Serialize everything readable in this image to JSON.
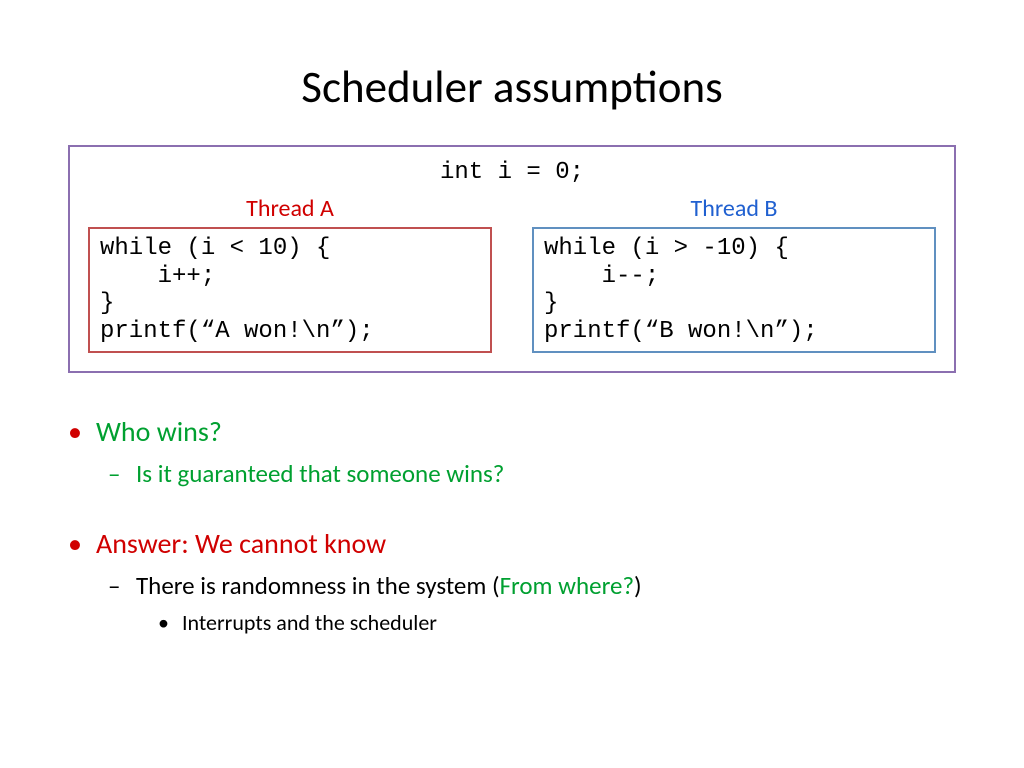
{
  "title": "Scheduler assumptions",
  "sharedCode": "int i = 0;",
  "threadA": {
    "label": "Thread A",
    "code": "while (i < 10) {\n    i++;\n}\nprintf(“A won!\\n”);"
  },
  "threadB": {
    "label": "Thread B",
    "code": "while (i > -10) {\n    i--;\n}\nprintf(“B won!\\n”);"
  },
  "bullets": {
    "q1": "Who wins?",
    "q1sub": "Is it guaranteed that someone wins?",
    "answer": "Answer: We cannot know",
    "answerSubPre": "There is randomness in the system (",
    "answerSubGreen": "From where?",
    "answerSubPost": ")",
    "answerSubSub": "Interrupts and the scheduler"
  }
}
